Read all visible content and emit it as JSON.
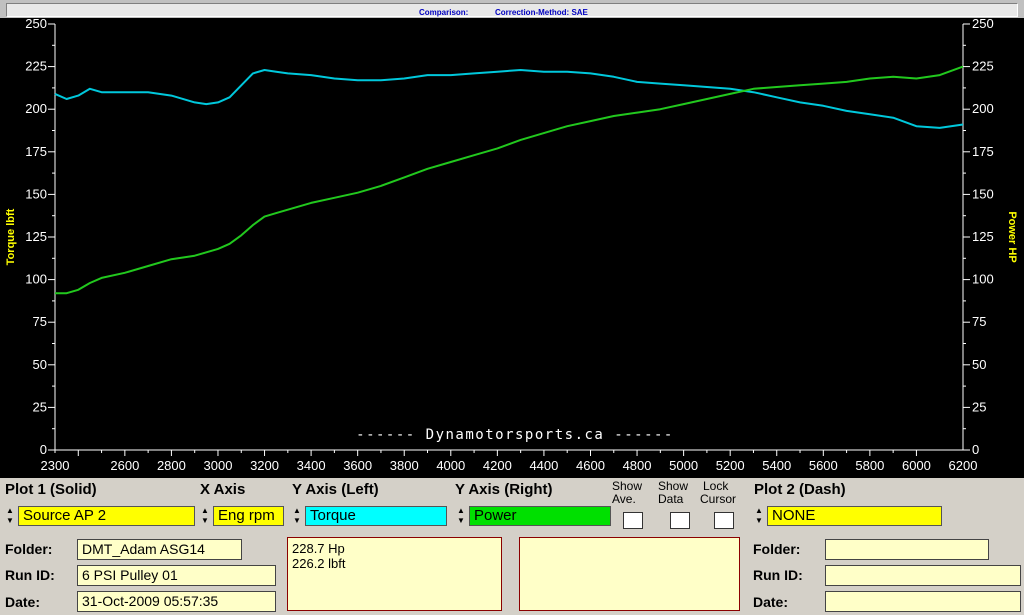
{
  "titlebar": {
    "comparison": "Comparison:",
    "correction": "Correction-Method: SAE"
  },
  "chart_data": {
    "type": "line",
    "watermark": "------ Dynamotorsports.ca ------",
    "xlim": [
      2300,
      6200
    ],
    "x_ticks": [
      "2300",
      "2600",
      "2800",
      "3000",
      "3200",
      "3400",
      "3600",
      "3800",
      "4000",
      "4200",
      "4400",
      "4600",
      "4800",
      "5000",
      "5200",
      "5400",
      "5600",
      "5800",
      "6000",
      "6200"
    ],
    "ylim": [
      0,
      250
    ],
    "y_ticks": [
      "0",
      "25",
      "50",
      "75",
      "100",
      "125",
      "150",
      "175",
      "200",
      "225",
      "250"
    ],
    "ylabel_left": "Torque lbft",
    "ylabel_right": "Power HP",
    "grid": false,
    "colors": {
      "axes": "#ffffff",
      "label": "#ffff00",
      "watermark": "#ffffff"
    },
    "series": [
      {
        "color": "#00c8dc",
        "x": [
          2300,
          2350,
          2400,
          2450,
          2500,
          2550,
          2600,
          2700,
          2800,
          2900,
          2950,
          3000,
          3050,
          3100,
          3150,
          3200,
          3250,
          3300,
          3400,
          3500,
          3600,
          3700,
          3800,
          3900,
          4000,
          4100,
          4200,
          4300,
          4400,
          4500,
          4600,
          4700,
          4800,
          4900,
          5000,
          5100,
          5200,
          5300,
          5400,
          5500,
          5600,
          5700,
          5800,
          5900,
          6000,
          6100,
          6200
        ],
        "y": [
          209,
          206,
          208,
          212,
          210,
          210,
          210,
          210,
          208,
          204,
          203,
          204,
          207,
          214,
          221,
          223,
          222,
          221,
          220,
          218,
          217,
          217,
          218,
          220,
          220,
          221,
          222,
          223,
          222,
          222,
          221,
          219,
          216,
          215,
          214,
          213,
          212,
          210,
          207,
          204,
          202,
          199,
          197,
          195,
          190,
          189,
          191
        ]
      },
      {
        "color": "#22c81e",
        "x": [
          2300,
          2350,
          2400,
          2450,
          2500,
          2600,
          2700,
          2800,
          2900,
          3000,
          3050,
          3100,
          3150,
          3200,
          3250,
          3300,
          3400,
          3500,
          3600,
          3700,
          3800,
          3900,
          4000,
          4100,
          4200,
          4300,
          4400,
          4500,
          4600,
          4700,
          4800,
          4900,
          5000,
          5100,
          5200,
          5300,
          5400,
          5500,
          5600,
          5700,
          5800,
          5900,
          6000,
          6100,
          6200
        ],
        "y": [
          92,
          92,
          94,
          98,
          101,
          104,
          108,
          112,
          114,
          118,
          121,
          126,
          132,
          137,
          139,
          141,
          145,
          148,
          151,
          155,
          160,
          165,
          169,
          173,
          177,
          182,
          186,
          190,
          193,
          196,
          198,
          200,
          203,
          206,
          209,
          212,
          213,
          214,
          215,
          216,
          218,
          219,
          218,
          220,
          225
        ]
      }
    ]
  },
  "controls": {
    "plot1": {
      "title": "Plot 1 (Solid)",
      "source": "Source AP 2",
      "color": "#ffff00"
    },
    "xaxis": {
      "title": "X Axis",
      "value": "Eng rpm",
      "color": "#ffff00"
    },
    "yleft": {
      "title": "Y Axis (Left)",
      "value": "Torque",
      "color": "#00ffff"
    },
    "yright": {
      "title": "Y Axis (Right)",
      "value": "Power",
      "color": "#00e000"
    },
    "show_ave": {
      "line1": "Show",
      "line2": "Ave."
    },
    "show_data": {
      "line1": "Show",
      "line2": "Data"
    },
    "lock_cursor": {
      "line1": "Lock",
      "line2": "Cursor"
    },
    "plot2": {
      "title": "Plot 2 (Dash)",
      "source": "NONE",
      "color": "#ffff00"
    }
  },
  "info1": {
    "folder_label": "Folder:",
    "folder": "DMT_Adam ASG14",
    "run_label": "Run ID:",
    "run": "6 PSI Pulley 01",
    "date_label": "Date:",
    "date": "31-Oct-2009  05:57:35"
  },
  "readout1": {
    "line1": "228.7 Hp",
    "line2": "226.2 lbft"
  },
  "readout2": {
    "line1": "",
    "line2": ""
  },
  "info2": {
    "folder_label": "Folder:",
    "folder": "",
    "run_label": "Run ID:",
    "run": "",
    "date_label": "Date:",
    "date": ""
  }
}
